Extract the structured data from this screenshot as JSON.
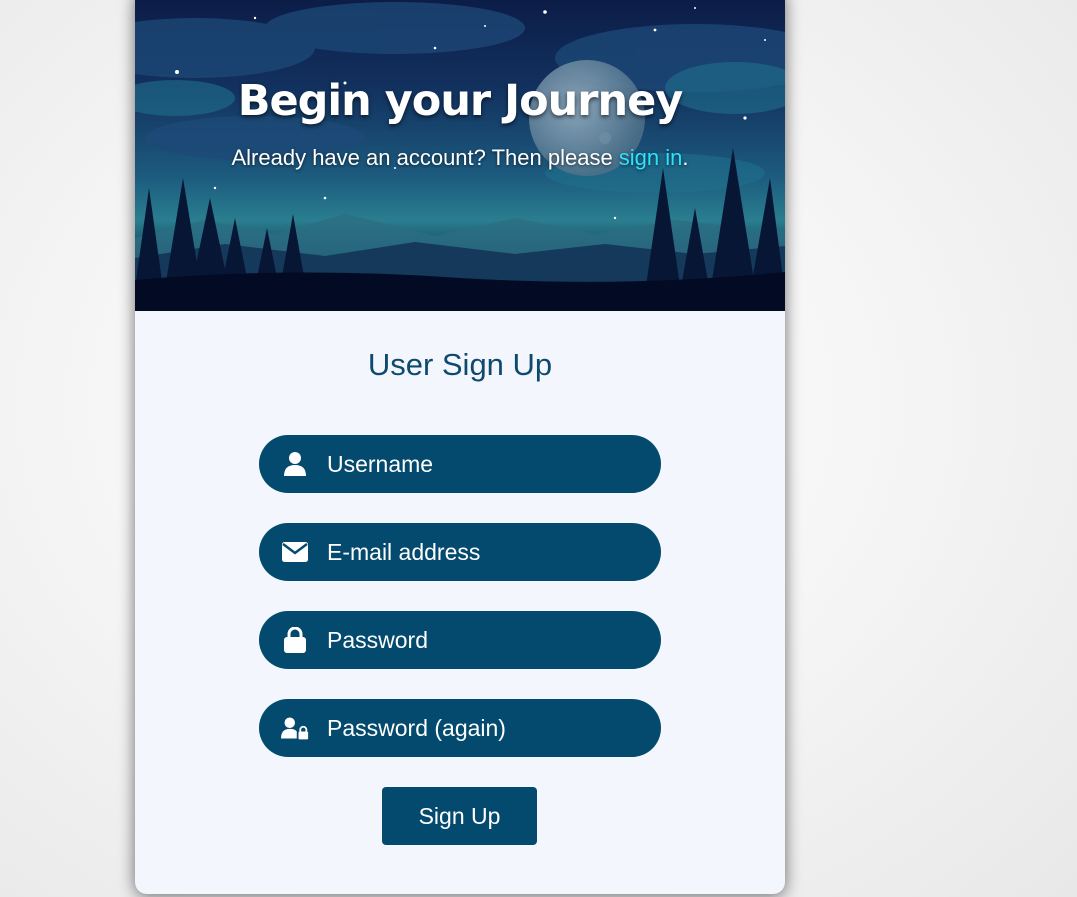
{
  "hero": {
    "title": "Begin your Journey",
    "subtitle_prefix": "Already have an account? Then please ",
    "signin_link": "sign in",
    "subtitle_suffix": "."
  },
  "form": {
    "title": "User Sign Up",
    "fields": [
      {
        "placeholder": "Username",
        "icon": "user-icon",
        "type": "text"
      },
      {
        "placeholder": "E-mail address",
        "icon": "envelope-icon",
        "type": "email"
      },
      {
        "placeholder": "Password",
        "icon": "lock-icon",
        "type": "password"
      },
      {
        "placeholder": "Password (again)",
        "icon": "user-lock-icon",
        "type": "password"
      }
    ],
    "submit_label": "Sign Up"
  },
  "colors": {
    "primary": "#034a6e",
    "link": "#2fe0ff",
    "card_background": "#f3f7fd",
    "title_text": "#0f4a6e"
  }
}
